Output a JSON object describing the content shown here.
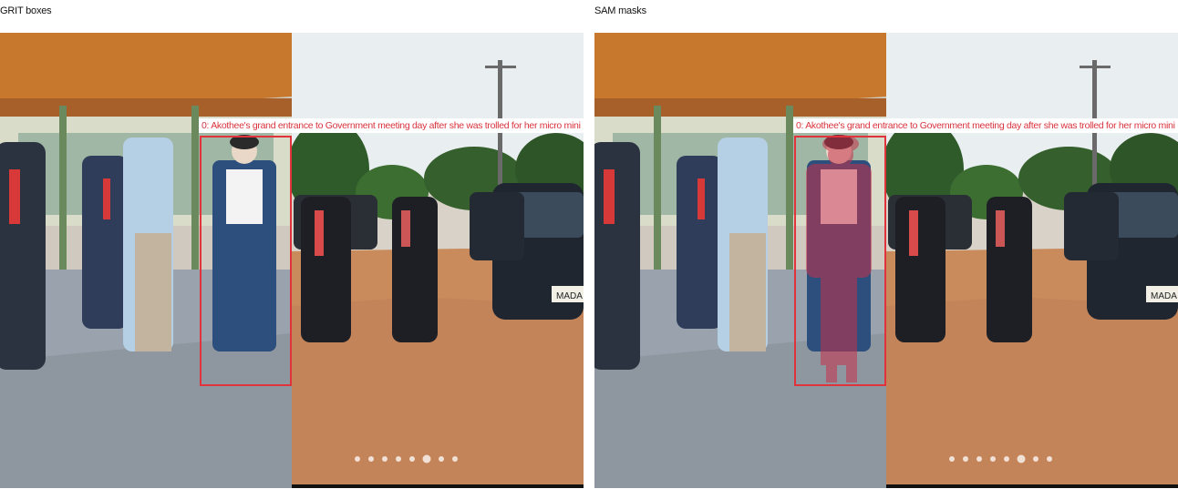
{
  "panels": {
    "left": {
      "title": "GRIT boxes"
    },
    "right": {
      "title": "SAM masks"
    }
  },
  "detection": {
    "label": "0: Akothee's grand entrance to Government meeting day after she was trolled for her micro mini",
    "color": "#e0333c",
    "mask_color": "#c8314a"
  },
  "photo": {
    "car_plate": "MADA",
    "carousel_dots": 8,
    "active_dot": 6
  }
}
